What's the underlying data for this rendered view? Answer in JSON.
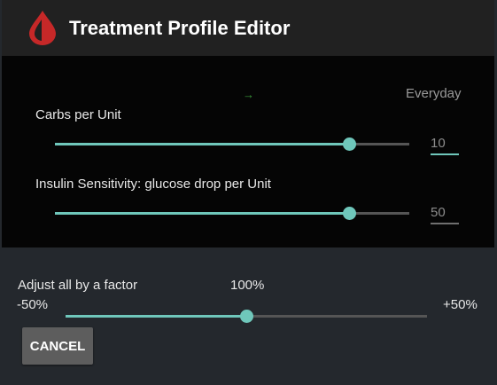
{
  "header": {
    "title": "Treatment Profile Editor",
    "icon": "blood-drop-icon",
    "accent": "#c62828"
  },
  "profile": {
    "arrow": "→",
    "day_label": "Everyday"
  },
  "carbs": {
    "label": "Carbs per Unit",
    "value": "10",
    "slider_fraction": 0.83
  },
  "sensitivity": {
    "label": "Insulin Sensitivity: glucose drop per Unit",
    "value": "50",
    "slider_fraction": 0.83
  },
  "factor": {
    "label": "Adjust all by a factor",
    "value": "100%",
    "min_label": "-50%",
    "max_label": "+50%",
    "slider_fraction": 0.5
  },
  "buttons": {
    "cancel": "CANCEL"
  },
  "colors": {
    "accent": "#6fc7bb"
  }
}
